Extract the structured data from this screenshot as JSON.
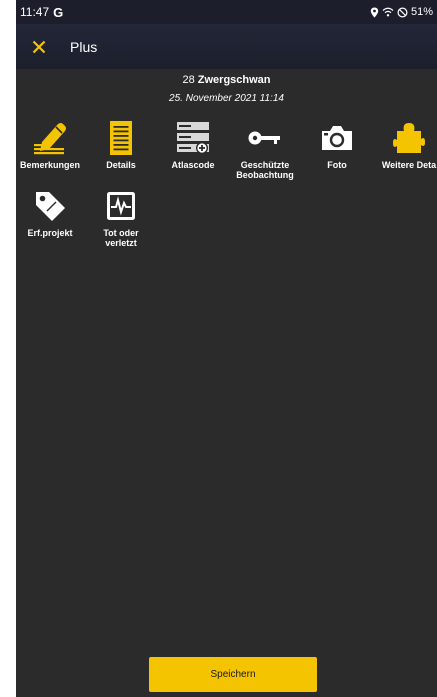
{
  "status_bar": {
    "time": "11:47",
    "carrier_glyph": "G",
    "battery": "51%"
  },
  "app_bar": {
    "title": "Plus",
    "close_icon": "close-x-icon",
    "accent": "#f5c400"
  },
  "observation": {
    "count": "28",
    "species": "Zwergschwan",
    "datetime": "25. November 2021 11:14"
  },
  "tiles": [
    {
      "label": "Bemerkungen",
      "icon": "pencil-lines-icon"
    },
    {
      "label": "Details",
      "icon": "document-list-icon"
    },
    {
      "label": "Atlascode",
      "icon": "database-add-icon"
    },
    {
      "label_line1": "Geschützte",
      "label_line2": "Beobachtung",
      "icon": "key-icon"
    },
    {
      "label": "Foto",
      "icon": "camera-icon"
    },
    {
      "label": "Weitere Deta",
      "icon": "puzzle-icon"
    },
    {
      "label": "Erf.projekt",
      "icon": "tag-icon"
    },
    {
      "label_line1": "Tot oder",
      "label_line2": "verletzt",
      "icon": "pulse-monitor-icon"
    }
  ],
  "save_button": {
    "label": "Speichern",
    "color": "#f5c400"
  }
}
